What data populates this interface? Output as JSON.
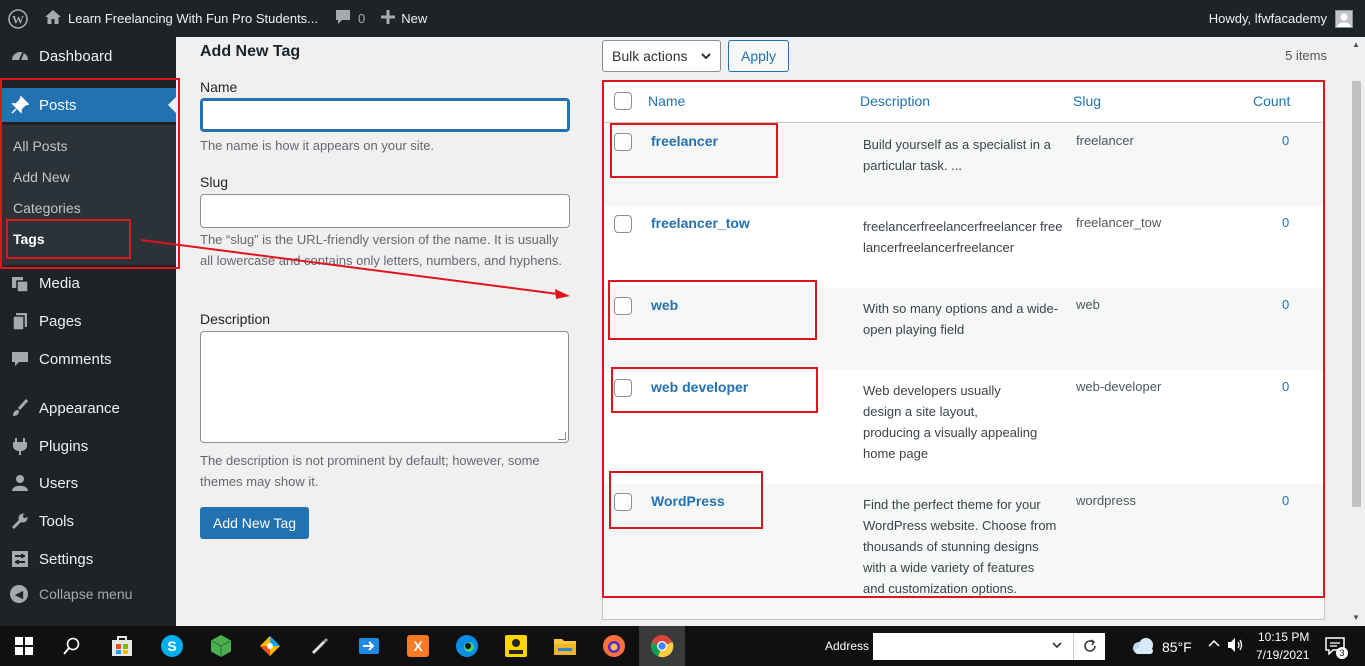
{
  "admin_bar": {
    "site_title": "Learn Freelancing With Fun Pro Students...",
    "comments_count": "0",
    "new_label": "New",
    "howdy": "Howdy, lfwfacademy"
  },
  "sidebar": {
    "dashboard": "Dashboard",
    "posts": "Posts",
    "submenu": [
      "All Posts",
      "Add New",
      "Categories",
      "Tags"
    ],
    "media": "Media",
    "pages": "Pages",
    "comments": "Comments",
    "appearance": "Appearance",
    "plugins": "Plugins",
    "users": "Users",
    "tools": "Tools",
    "settings": "Settings",
    "collapse": "Collapse menu"
  },
  "form": {
    "title": "Add New Tag",
    "name_label": "Name",
    "name_value": "",
    "name_help": "The name is how it appears on your site.",
    "slug_label": "Slug",
    "slug_value": "",
    "slug_help": "The “slug” is the URL-friendly version of the name. It is usually all lowercase and contains only letters, numbers, and hyphens.",
    "description_label": "Description",
    "description_value": "",
    "description_help": "The description is not prominent by default; however, some themes may show it.",
    "submit": "Add New Tag"
  },
  "list": {
    "bulk_actions": "Bulk actions",
    "apply": "Apply",
    "items_count": "5 items",
    "columns": {
      "name": "Name",
      "description": "Description",
      "slug": "Slug",
      "count": "Count"
    },
    "rows": [
      {
        "name": "freelancer",
        "description": "Build yourself as a specialist in a particular task. ...",
        "slug": "freelancer",
        "count": "0"
      },
      {
        "name": "freelancer_tow",
        "description": "freelancerfreelancerfreelancer freelancerfreelancerfreelancer",
        "slug": "freelancer_tow",
        "count": "0"
      },
      {
        "name": "web",
        "description": "With so many options and a wide-open playing field",
        "slug": "web",
        "count": "0"
      },
      {
        "name": "web developer",
        "description": "Web developers usually design a site layout, producing a visually appealing home page",
        "slug": "web-developer",
        "count": "0"
      },
      {
        "name": "WordPress",
        "description": "Find the perfect theme for your WordPress website. Choose from thousands of stunning designs with a wide variety of features and customization options.",
        "slug": "wordpress",
        "count": "0"
      }
    ]
  },
  "taskbar": {
    "address_label": "Address",
    "address_value": "",
    "temperature": "85°F",
    "time": "10:15 PM",
    "date": "7/19/2021",
    "notifications": "3"
  },
  "colors": {
    "admin_dark": "#1d2327",
    "accent_blue": "#2271b1",
    "annotation_red": "#e0141e"
  },
  "icons": [
    "wordpress-logo-icon",
    "home-icon",
    "comment-bubble-icon",
    "plus-icon",
    "dashboard-icon",
    "pin-icon",
    "media-icon",
    "pages-icon",
    "comments-icon",
    "brush-icon",
    "plug-icon",
    "user-icon",
    "wrench-icon",
    "settings-icon",
    "collapse-icon",
    "chevron-down-icon",
    "windows-start-icon",
    "search-icon"
  ]
}
